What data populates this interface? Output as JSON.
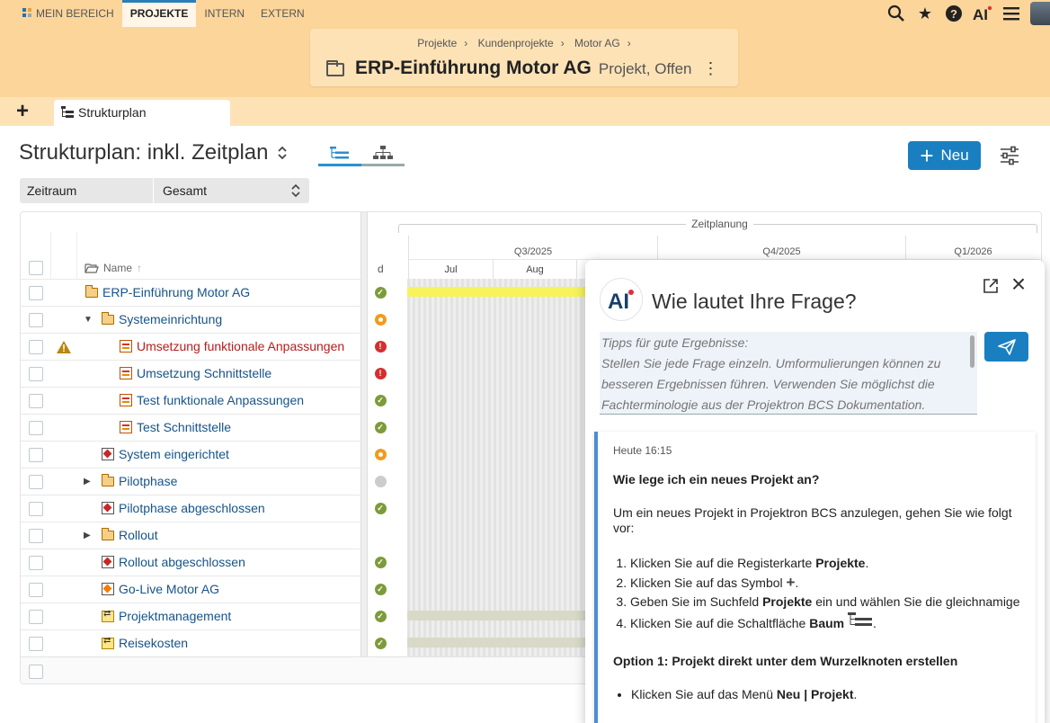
{
  "nav": {
    "tabs": [
      {
        "label": "Mein Bereich",
        "icon": "grid-icon"
      },
      {
        "label": "Projekte",
        "active": true
      },
      {
        "label": "Intern"
      },
      {
        "label": "Extern"
      }
    ],
    "icons": [
      "search-icon",
      "star-icon",
      "help-icon",
      "ai-icon",
      "menu-icon",
      "avatar"
    ]
  },
  "header": {
    "breadcrumbs": [
      "Projekte",
      "Kundenprojekte",
      "Motor AG"
    ],
    "separator": "›",
    "title": "ERP-Einführung Motor AG",
    "subtitle": "Projekt, Offen"
  },
  "tabs": {
    "add_label": "+",
    "items": [
      {
        "label": "Strukturplan",
        "active": true
      }
    ]
  },
  "toolbar": {
    "heading": "Strukturplan: inkl. Zeitplan",
    "new_button": "Neu",
    "view_modes": [
      "list-tree-icon",
      "org-tree-icon"
    ]
  },
  "filter": {
    "label": "Zeitraum",
    "value": "Gesamt"
  },
  "table": {
    "col_name": "Name",
    "col_d": "d",
    "rows": [
      {
        "name": "ERP-Einführung Motor AG",
        "type": "folder",
        "level": 0,
        "status": "ok"
      },
      {
        "name": "Systemeinrichtung",
        "type": "folder",
        "level": 1,
        "expander": "expanded",
        "status": "warn"
      },
      {
        "name": "Umsetzung funktionale Anpassungen",
        "type": "task",
        "level": 2,
        "status": "err",
        "flag": true,
        "red": true
      },
      {
        "name": "Umsetzung Schnittstelle",
        "type": "task",
        "level": 2,
        "status": "err"
      },
      {
        "name": "Test funktionale Anpassungen",
        "type": "task",
        "level": 2,
        "status": "ok"
      },
      {
        "name": "Test Schnittstelle",
        "type": "task",
        "level": 2,
        "status": "ok"
      },
      {
        "name": "System eingerichtet",
        "type": "milestone",
        "level": 1,
        "status": "warn"
      },
      {
        "name": "Pilotphase",
        "type": "folder",
        "level": 1,
        "expander": "collapsed",
        "status": "grey"
      },
      {
        "name": "Pilotphase abgeschlossen",
        "type": "milestone",
        "level": 1,
        "status": "ok"
      },
      {
        "name": "Rollout",
        "type": "folder",
        "level": 1,
        "expander": "collapsed",
        "status": ""
      },
      {
        "name": "Rollout abgeschlossen",
        "type": "milestone",
        "level": 1,
        "status": "ok"
      },
      {
        "name": "Go-Live Motor AG",
        "type": "golive",
        "level": 1,
        "status": "ok"
      },
      {
        "name": "Projektmanagement",
        "type": "pm",
        "level": 1,
        "status": "ok"
      },
      {
        "name": "Reisekosten",
        "type": "pm",
        "level": 1,
        "status": "ok"
      }
    ]
  },
  "gantt": {
    "title": "Zeitplanung",
    "quarters": [
      "Q3/2025",
      "Q4/2025",
      "Q1/2026"
    ],
    "months": [
      "Jul",
      "Aug"
    ],
    "colors": {
      "root": "#f7f35a",
      "pm": "#d9d9c8"
    }
  },
  "chat": {
    "title": "Wie lautet Ihre Frage?",
    "placeholder": "Tipps für gute Ergebnisse:\nStellen Sie jede Frage einzeln. Umformulierungen können zu besseren Ergebnissen führen. Verwenden Sie möglichst die Fachterminologie aus der Projektron BCS Dokumentation. Geben",
    "timestamp": "Heute 16:15",
    "question": "Wie lege ich ein neues Projekt an?",
    "intro": "Um ein neues Projekt in Projektron BCS anzulegen, gehen Sie wie folgt vor:",
    "steps": [
      {
        "pre": "Klicken Sie auf die Registerkarte ",
        "bold": "Projekte",
        "post": "."
      },
      {
        "pre": "Klicken Sie auf das Symbol ",
        "bold": "",
        "post": ".",
        "icon": "plus-icon"
      },
      {
        "pre": "Geben Sie im Suchfeld ",
        "bold": "Projekte",
        "post": " ein und wählen Sie die gleichnamige"
      },
      {
        "pre": "Klicken Sie auf die Schaltfläche ",
        "bold": "Baum",
        "post": ".",
        "icon": "tree-icon"
      }
    ],
    "option1": "Option 1: Projekt direkt unter dem Wurzelknoten erstellen",
    "bullet_pre": "Klicken Sie auf das Menü ",
    "bullet_bold": "Neu | Projekt",
    "bullet_post": "."
  }
}
